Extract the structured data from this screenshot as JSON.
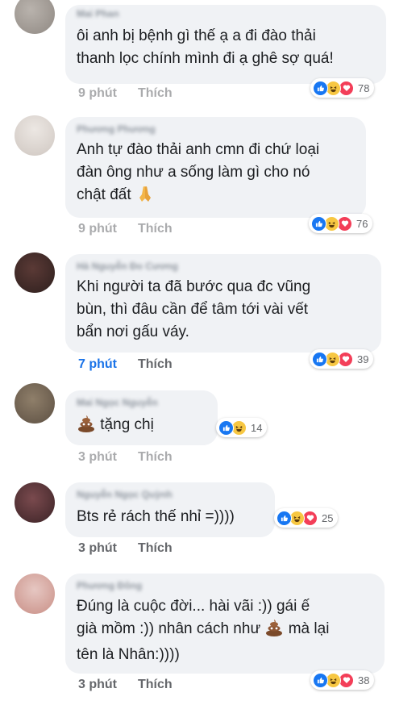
{
  "comments": [
    {
      "author": "Mai Phan",
      "text": "ôi anh bị bệnh gì thế ạ a đi đào thải\nthanh lọc chính mình đi ạ ghê sợ quá!",
      "reactions": "78",
      "time": "9 phút",
      "like_label": "Thích"
    },
    {
      "author": "Phương Phương",
      "text_lines": [
        "Anh tự đào thải anh cmn đi chứ loại",
        "đàn ông như a sống làm gì cho nó",
        "chật đất"
      ],
      "reactions": "76",
      "time": "9 phút",
      "like_label": "Thích"
    },
    {
      "author": "Hà Nguyễn Đo Cương",
      "text": "Khi người ta đã bước qua đc vũng\nbùn, thì đâu cần để tâm tới vài vết\nbẩn nơi gấu váy.",
      "reactions": "39",
      "time": "7 phút",
      "like_label": "Thích"
    },
    {
      "author": "Mai Ngọc Nguyễn",
      "text": "tặng chị",
      "reactions": "14",
      "time": "3 phút",
      "like_label": "Thích"
    },
    {
      "author": "Nguyễn Ngọc Quỳnh",
      "text": "Bts rẻ rách thế nhỉ =))))",
      "reactions": "25",
      "time": "3 phút",
      "like_label": "Thích"
    },
    {
      "author": "Phương Đông",
      "text_lines": [
        "Đúng là cuộc đời... hài vãi :)) gái ế",
        "già mồm :)) nhân cách như",
        "mà lại",
        "tên là Nhân:))))"
      ],
      "reactions": "38",
      "time": "3 phút",
      "like_label": "Thích"
    }
  ],
  "colors": {
    "bubble": "#f0f2f5",
    "like_blue": "#1877f2",
    "haha_yellow": "#f7c742",
    "love_red": "#f33e58",
    "active_time": "#1a73e8",
    "meta_gray": "#65676b"
  },
  "icons": [
    "like-reaction-icon",
    "haha-reaction-icon",
    "love-reaction-icon",
    "praying-hands-emoji",
    "poop-emoji"
  ]
}
